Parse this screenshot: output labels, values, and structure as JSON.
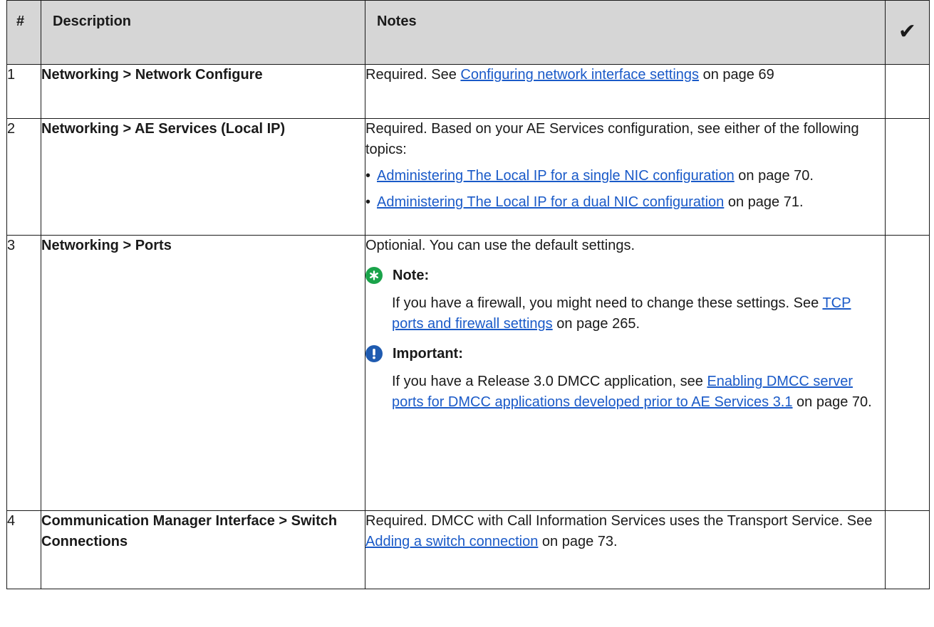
{
  "headers": {
    "num": "#",
    "description": "Description",
    "notes": "Notes",
    "check": "✔"
  },
  "rows": [
    {
      "num": "1",
      "description": "Networking > Network Configure",
      "required": "Required. See ",
      "link": "Configuring network interface settings",
      "after": " on page 69"
    },
    {
      "num": "2",
      "description": "Networking > AE Services (Local IP)",
      "intro": "Required. Based on your AE Services configuration, see either of the following topics:",
      "bullets": [
        {
          "link": "Administering The Local IP for a single NIC configuration",
          "after": " on page 70."
        },
        {
          "link": "Administering The Local IP for a dual NIC configuration",
          "after": " on page 71."
        }
      ]
    },
    {
      "num": "3",
      "description": "Networking > Ports",
      "intro": "Optionial. You can use the default settings.",
      "note": {
        "label": "Note:",
        "text_before": "If you have a firewall, you might need to change these settings. See ",
        "link": "TCP ports and firewall settings",
        "after": " on page 265."
      },
      "important": {
        "label": "Important:",
        "text_before": "If you have a Release 3.0 DMCC application, see ",
        "link": "Enabling DMCC server ports for DMCC applications developed prior to AE Services 3.1",
        "after": " on page 70."
      }
    },
    {
      "num": "4",
      "description": "Communication Manager Interface > Switch Connections",
      "required": "Required. DMCC with Call Information Services uses the Transport Service. See ",
      "link": "Adding a switch connection",
      "after": " on page 73."
    }
  ],
  "icons": {
    "note": "asterisk-icon",
    "important": "exclamation-icon"
  },
  "colors": {
    "link": "#1a5ac8",
    "header_bg": "#d6d6d6",
    "note_icon": "#1aa34a",
    "important_icon": "#1f5bb0"
  }
}
